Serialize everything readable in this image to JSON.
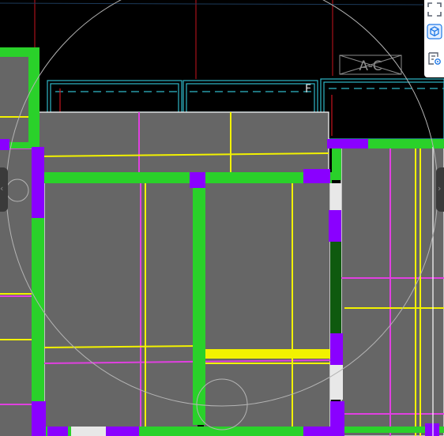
{
  "canvas": {
    "background": "#000000",
    "slab_fill": "#666666",
    "colors": {
      "beam_green": "#2ad12a",
      "column_purple": "#8a00ff",
      "rebar_yellow": "#f2f200",
      "rebar_magenta": "#e040e0",
      "wall_cyan": "#2fb8c8",
      "axis_red": "#c8141e",
      "focus_circle": "#b4b4b4",
      "dark_green": "#0e5a0e"
    },
    "grid_label": "A-C",
    "point_label": "F"
  },
  "toolbar": {
    "buttons": [
      {
        "name": "fullscreen",
        "icon": "fullscreen-icon"
      },
      {
        "name": "3d-view",
        "icon": "cube-icon"
      },
      {
        "name": "view-list",
        "icon": "list-view-icon"
      }
    ]
  },
  "handles": {
    "left": "collapse-left",
    "right": "expand-right"
  }
}
